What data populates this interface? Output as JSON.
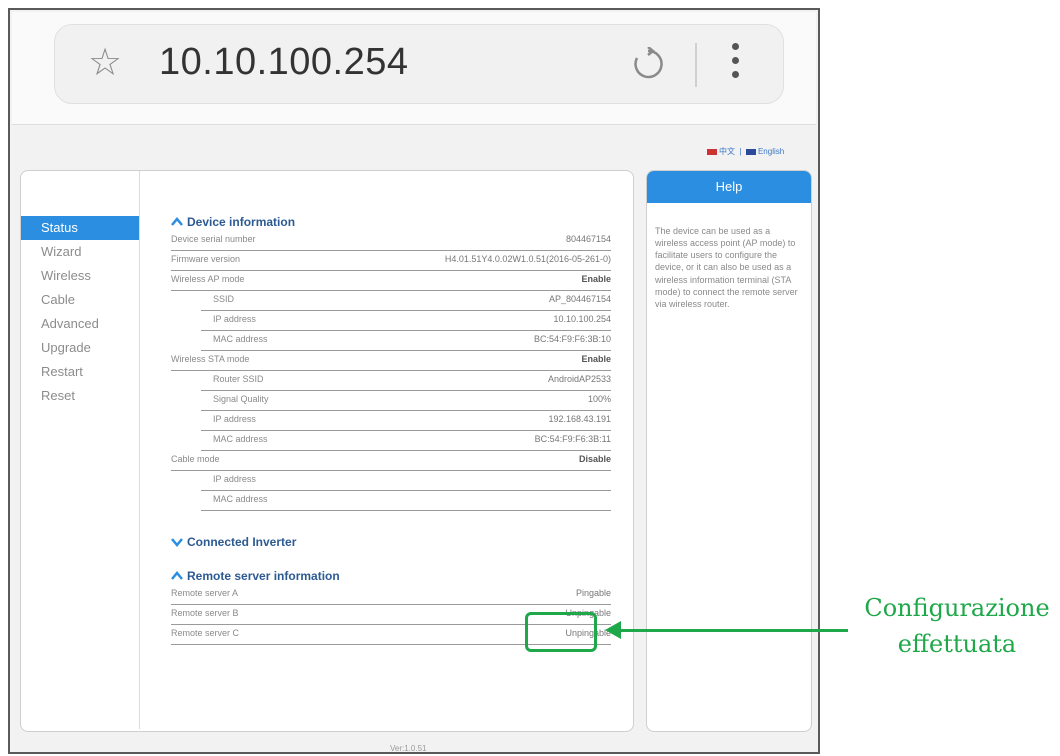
{
  "browser": {
    "url": "10.10.100.254",
    "icons": [
      "star-icon",
      "reload-icon",
      "more-vert-icon"
    ]
  },
  "language_links": [
    "中文",
    "English"
  ],
  "sidebar": {
    "items": [
      {
        "label": "Status",
        "active": true
      },
      {
        "label": "Wizard"
      },
      {
        "label": "Wireless"
      },
      {
        "label": "Cable"
      },
      {
        "label": "Advanced"
      },
      {
        "label": "Upgrade"
      },
      {
        "label": "Restart"
      },
      {
        "label": "Reset"
      }
    ]
  },
  "device_info": {
    "title": "Device information",
    "rows": [
      {
        "label": "Device serial number",
        "value": "804467154"
      },
      {
        "label": "Firmware version",
        "value": "H4.01.51Y4.0.02W1.0.51(2016-05-261-0)"
      },
      {
        "label": "Wireless AP mode",
        "value": "Enable"
      },
      {
        "label": "SSID",
        "value": "AP_804467154"
      },
      {
        "label": "IP address",
        "value": "10.10.100.254"
      },
      {
        "label": "MAC address",
        "value": "BC:54:F9:F6:3B:10"
      },
      {
        "label": "Wireless STA mode",
        "value": "Enable"
      },
      {
        "label": "Router SSID",
        "value": "AndroidAP2533"
      },
      {
        "label": "Signal Quality",
        "value": "100%"
      },
      {
        "label": "IP address",
        "value": "192.168.43.191"
      },
      {
        "label": "MAC address",
        "value": "BC:54:F9:F6:3B:11"
      },
      {
        "label": "Cable mode",
        "value": "Disable"
      },
      {
        "label": "IP address",
        "value": ""
      },
      {
        "label": "MAC address",
        "value": ""
      }
    ]
  },
  "connected_inverter": {
    "title": "Connected Inverter"
  },
  "remote_server": {
    "title": "Remote server information",
    "rows": [
      {
        "label": "Remote server A",
        "value": "Pingable"
      },
      {
        "label": "Remote server B",
        "value": "Unpingable"
      },
      {
        "label": "Remote server C",
        "value": "Unpingable"
      }
    ]
  },
  "help": {
    "title": "Help",
    "text": "The device can be used as a wireless access point (AP mode) to facilitate users to configure the device, or it can also be used as a wireless information terminal (STA mode) to connect the remote server via wireless router."
  },
  "footer": {
    "version": "Ver:1.0.51"
  },
  "annotation": {
    "line1": "Configurazione",
    "line2": "effettuata"
  },
  "colors": {
    "accent": "#2c8ee0",
    "annotation": "#1fa84a"
  }
}
